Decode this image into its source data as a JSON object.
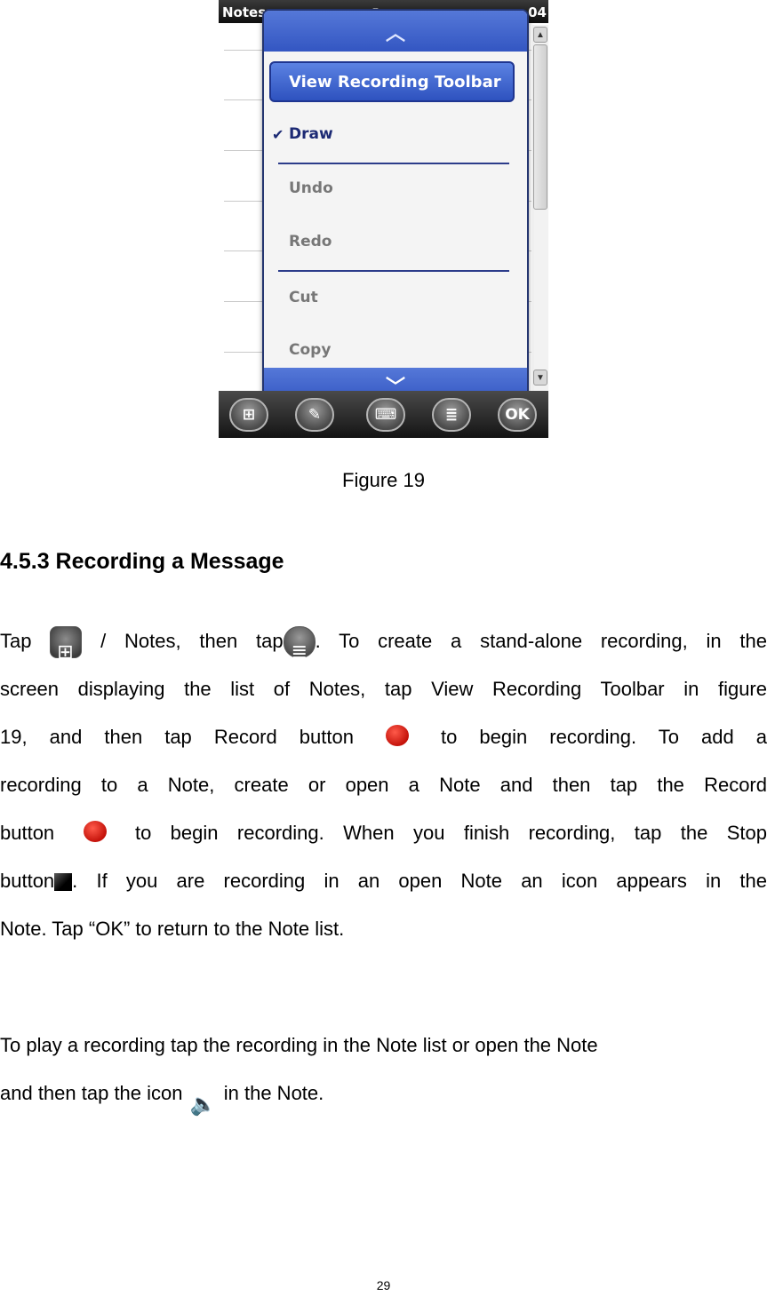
{
  "figure": {
    "app_title": "Notes",
    "clock": "04",
    "menu": {
      "items": [
        "View Recording Toolbar",
        "Draw",
        "Undo",
        "Redo",
        "Cut",
        "Copy"
      ],
      "checked": "Draw"
    },
    "taskbar_ok": "OK"
  },
  "caption": "Figure 19",
  "heading": "4.5.3 Recording a Message",
  "body": {
    "p1_a": "Tap",
    "p1_b": "/ Notes, then tap",
    "p1_c": ". To create a stand-alone recording, in the",
    "p1_l2": "screen displaying the list of Notes, tap View Recording Toolbar in figure",
    "p1_l3a": "19, and then tap Record button",
    "p1_l3b": "to begin recording. To add a",
    "p1_l4": "recording to a Note, create or open a Note and then tap the Record",
    "p1_l5a": "button",
    "p1_l5b": "to begin recording. When you finish recording, tap the Stop",
    "p1_l6a": "button",
    "p1_l6b": ". If you are recording in an open Note an icon appears in the",
    "p1_l7": "Note. Tap “OK” to return to the Note list.",
    "p2_l1": "To play a recording tap the recording in the Note list or open the Note",
    "p2_l2a": "and then tap the icon",
    "p2_l2b": "in the Note."
  },
  "page_number": "29"
}
